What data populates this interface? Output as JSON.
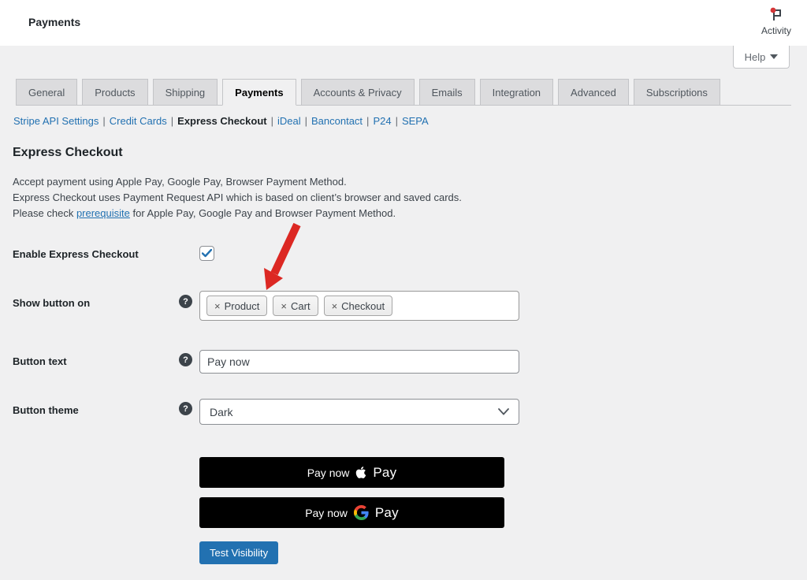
{
  "header": {
    "title": "Payments",
    "activity_label": "Activity"
  },
  "help_button": {
    "label": "Help"
  },
  "tabs": [
    {
      "label": "General",
      "active": false
    },
    {
      "label": "Products",
      "active": false
    },
    {
      "label": "Shipping",
      "active": false
    },
    {
      "label": "Payments",
      "active": true
    },
    {
      "label": "Accounts & Privacy",
      "active": false
    },
    {
      "label": "Emails",
      "active": false
    },
    {
      "label": "Integration",
      "active": false
    },
    {
      "label": "Advanced",
      "active": false
    },
    {
      "label": "Subscriptions",
      "active": false
    }
  ],
  "subnav": {
    "separator": "|",
    "items": [
      {
        "label": "Stripe API Settings",
        "current": false
      },
      {
        "label": "Credit Cards",
        "current": false
      },
      {
        "label": "Express Checkout",
        "current": true
      },
      {
        "label": "iDeal",
        "current": false
      },
      {
        "label": "Bancontact",
        "current": false
      },
      {
        "label": "P24",
        "current": false
      },
      {
        "label": "SEPA",
        "current": false
      }
    ]
  },
  "section": {
    "title": "Express Checkout",
    "line1": "Accept payment using Apple Pay, Google Pay, Browser Payment Method.",
    "line2": "Express Checkout uses Payment Request API which is based on client’s browser and saved cards.",
    "line3_prefix": "Please check ",
    "line3_link": "prerequisite",
    "line3_suffix": " for Apple Pay, Google Pay and Browser Payment Method."
  },
  "form": {
    "enable": {
      "label": "Enable Express Checkout",
      "checked": true
    },
    "show_button_on": {
      "label": "Show button on",
      "tags": [
        {
          "remove": "×",
          "label": "Product"
        },
        {
          "remove": "×",
          "label": "Cart"
        },
        {
          "remove": "×",
          "label": "Checkout"
        }
      ]
    },
    "button_text": {
      "label": "Button text",
      "value": "Pay now"
    },
    "button_theme": {
      "label": "Button theme",
      "value": "Dark"
    }
  },
  "preview": {
    "apple": {
      "pay_text": "Pay now",
      "brand": "Pay"
    },
    "google": {
      "pay_text": "Pay now",
      "brand": "Pay"
    }
  },
  "actions": {
    "test_visibility": "Test Visibility"
  },
  "icons": {
    "help_glyph": "?"
  },
  "colors": {
    "accent_blue": "#2271b1",
    "arrow_red": "#dc2823",
    "page_bg": "#f0f0f1",
    "header_bg": "#ffffff",
    "button_black": "#000000",
    "notification_red": "#d63638"
  }
}
